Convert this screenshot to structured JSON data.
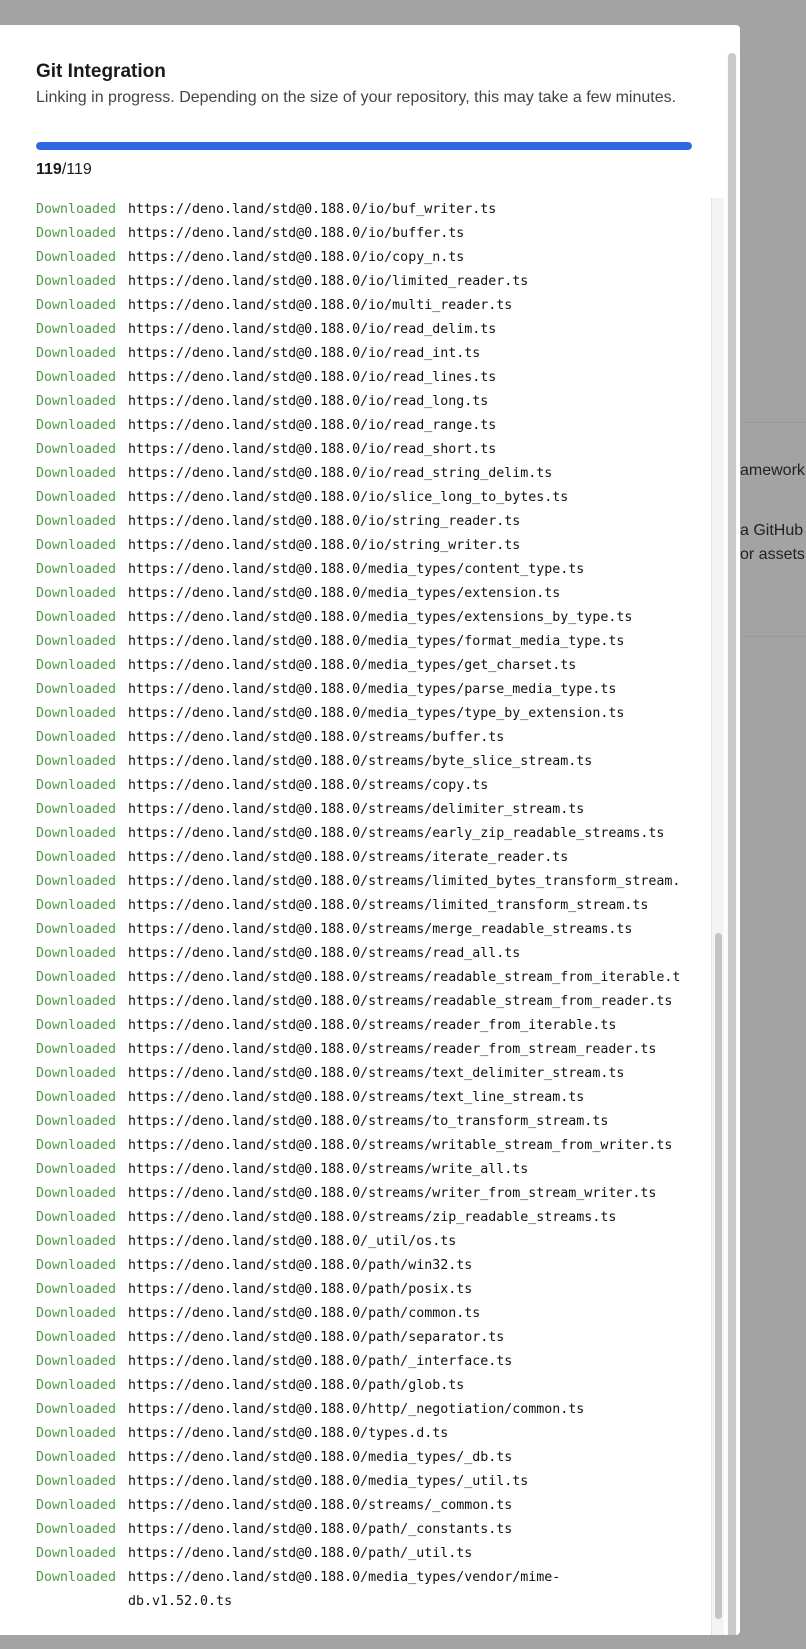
{
  "background": {
    "fragments_right": [
      "amework,",
      "a GitHub",
      "or assets"
    ]
  },
  "modal": {
    "title": "Git Integration",
    "subtitle": "Linking in progress. Depending on the size of your repository, this may take a few minutes.",
    "progress": {
      "current": "119",
      "separator": "/",
      "total": "119",
      "fraction": 1.0
    },
    "accent_color": "#2f67e0",
    "status_color": "#4e9a47"
  },
  "log": [
    {
      "status": "Downloaded",
      "url": "https://deno.land/std@0.188.0/io/buf_writer.ts"
    },
    {
      "status": "Downloaded",
      "url": "https://deno.land/std@0.188.0/io/buffer.ts"
    },
    {
      "status": "Downloaded",
      "url": "https://deno.land/std@0.188.0/io/copy_n.ts"
    },
    {
      "status": "Downloaded",
      "url": "https://deno.land/std@0.188.0/io/limited_reader.ts"
    },
    {
      "status": "Downloaded",
      "url": "https://deno.land/std@0.188.0/io/multi_reader.ts"
    },
    {
      "status": "Downloaded",
      "url": "https://deno.land/std@0.188.0/io/read_delim.ts"
    },
    {
      "status": "Downloaded",
      "url": "https://deno.land/std@0.188.0/io/read_int.ts"
    },
    {
      "status": "Downloaded",
      "url": "https://deno.land/std@0.188.0/io/read_lines.ts"
    },
    {
      "status": "Downloaded",
      "url": "https://deno.land/std@0.188.0/io/read_long.ts"
    },
    {
      "status": "Downloaded",
      "url": "https://deno.land/std@0.188.0/io/read_range.ts"
    },
    {
      "status": "Downloaded",
      "url": "https://deno.land/std@0.188.0/io/read_short.ts"
    },
    {
      "status": "Downloaded",
      "url": "https://deno.land/std@0.188.0/io/read_string_delim.ts"
    },
    {
      "status": "Downloaded",
      "url": "https://deno.land/std@0.188.0/io/slice_long_to_bytes.ts"
    },
    {
      "status": "Downloaded",
      "url": "https://deno.land/std@0.188.0/io/string_reader.ts"
    },
    {
      "status": "Downloaded",
      "url": "https://deno.land/std@0.188.0/io/string_writer.ts"
    },
    {
      "status": "Downloaded",
      "url": "https://deno.land/std@0.188.0/media_types/content_type.ts"
    },
    {
      "status": "Downloaded",
      "url": "https://deno.land/std@0.188.0/media_types/extension.ts"
    },
    {
      "status": "Downloaded",
      "url": "https://deno.land/std@0.188.0/media_types/extensions_by_type.ts"
    },
    {
      "status": "Downloaded",
      "url": "https://deno.land/std@0.188.0/media_types/format_media_type.ts"
    },
    {
      "status": "Downloaded",
      "url": "https://deno.land/std@0.188.0/media_types/get_charset.ts"
    },
    {
      "status": "Downloaded",
      "url": "https://deno.land/std@0.188.0/media_types/parse_media_type.ts"
    },
    {
      "status": "Downloaded",
      "url": "https://deno.land/std@0.188.0/media_types/type_by_extension.ts"
    },
    {
      "status": "Downloaded",
      "url": "https://deno.land/std@0.188.0/streams/buffer.ts"
    },
    {
      "status": "Downloaded",
      "url": "https://deno.land/std@0.188.0/streams/byte_slice_stream.ts"
    },
    {
      "status": "Downloaded",
      "url": "https://deno.land/std@0.188.0/streams/copy.ts"
    },
    {
      "status": "Downloaded",
      "url": "https://deno.land/std@0.188.0/streams/delimiter_stream.ts"
    },
    {
      "status": "Downloaded",
      "url": "https://deno.land/std@0.188.0/streams/early_zip_readable_streams.ts"
    },
    {
      "status": "Downloaded",
      "url": "https://deno.land/std@0.188.0/streams/iterate_reader.ts"
    },
    {
      "status": "Downloaded",
      "url": "https://deno.land/std@0.188.0/streams/limited_bytes_transform_stream."
    },
    {
      "status": "Downloaded",
      "url": "https://deno.land/std@0.188.0/streams/limited_transform_stream.ts"
    },
    {
      "status": "Downloaded",
      "url": "https://deno.land/std@0.188.0/streams/merge_readable_streams.ts"
    },
    {
      "status": "Downloaded",
      "url": "https://deno.land/std@0.188.0/streams/read_all.ts"
    },
    {
      "status": "Downloaded",
      "url": "https://deno.land/std@0.188.0/streams/readable_stream_from_iterable.t"
    },
    {
      "status": "Downloaded",
      "url": "https://deno.land/std@0.188.0/streams/readable_stream_from_reader.ts"
    },
    {
      "status": "Downloaded",
      "url": "https://deno.land/std@0.188.0/streams/reader_from_iterable.ts"
    },
    {
      "status": "Downloaded",
      "url": "https://deno.land/std@0.188.0/streams/reader_from_stream_reader.ts"
    },
    {
      "status": "Downloaded",
      "url": "https://deno.land/std@0.188.0/streams/text_delimiter_stream.ts"
    },
    {
      "status": "Downloaded",
      "url": "https://deno.land/std@0.188.0/streams/text_line_stream.ts"
    },
    {
      "status": "Downloaded",
      "url": "https://deno.land/std@0.188.0/streams/to_transform_stream.ts"
    },
    {
      "status": "Downloaded",
      "url": "https://deno.land/std@0.188.0/streams/writable_stream_from_writer.ts"
    },
    {
      "status": "Downloaded",
      "url": "https://deno.land/std@0.188.0/streams/write_all.ts"
    },
    {
      "status": "Downloaded",
      "url": "https://deno.land/std@0.188.0/streams/writer_from_stream_writer.ts"
    },
    {
      "status": "Downloaded",
      "url": "https://deno.land/std@0.188.0/streams/zip_readable_streams.ts"
    },
    {
      "status": "Downloaded",
      "url": "https://deno.land/std@0.188.0/_util/os.ts"
    },
    {
      "status": "Downloaded",
      "url": "https://deno.land/std@0.188.0/path/win32.ts"
    },
    {
      "status": "Downloaded",
      "url": "https://deno.land/std@0.188.0/path/posix.ts"
    },
    {
      "status": "Downloaded",
      "url": "https://deno.land/std@0.188.0/path/common.ts"
    },
    {
      "status": "Downloaded",
      "url": "https://deno.land/std@0.188.0/path/separator.ts"
    },
    {
      "status": "Downloaded",
      "url": "https://deno.land/std@0.188.0/path/_interface.ts"
    },
    {
      "status": "Downloaded",
      "url": "https://deno.land/std@0.188.0/path/glob.ts"
    },
    {
      "status": "Downloaded",
      "url": "https://deno.land/std@0.188.0/http/_negotiation/common.ts"
    },
    {
      "status": "Downloaded",
      "url": "https://deno.land/std@0.188.0/types.d.ts"
    },
    {
      "status": "Downloaded",
      "url": "https://deno.land/std@0.188.0/media_types/_db.ts"
    },
    {
      "status": "Downloaded",
      "url": "https://deno.land/std@0.188.0/media_types/_util.ts"
    },
    {
      "status": "Downloaded",
      "url": "https://deno.land/std@0.188.0/streams/_common.ts"
    },
    {
      "status": "Downloaded",
      "url": "https://deno.land/std@0.188.0/path/_constants.ts"
    },
    {
      "status": "Downloaded",
      "url": "https://deno.land/std@0.188.0/path/_util.ts"
    },
    {
      "status": "Downloaded",
      "url": "https://deno.land/std@0.188.0/media_types/vendor/mime-\ndb.v1.52.0.ts"
    }
  ]
}
